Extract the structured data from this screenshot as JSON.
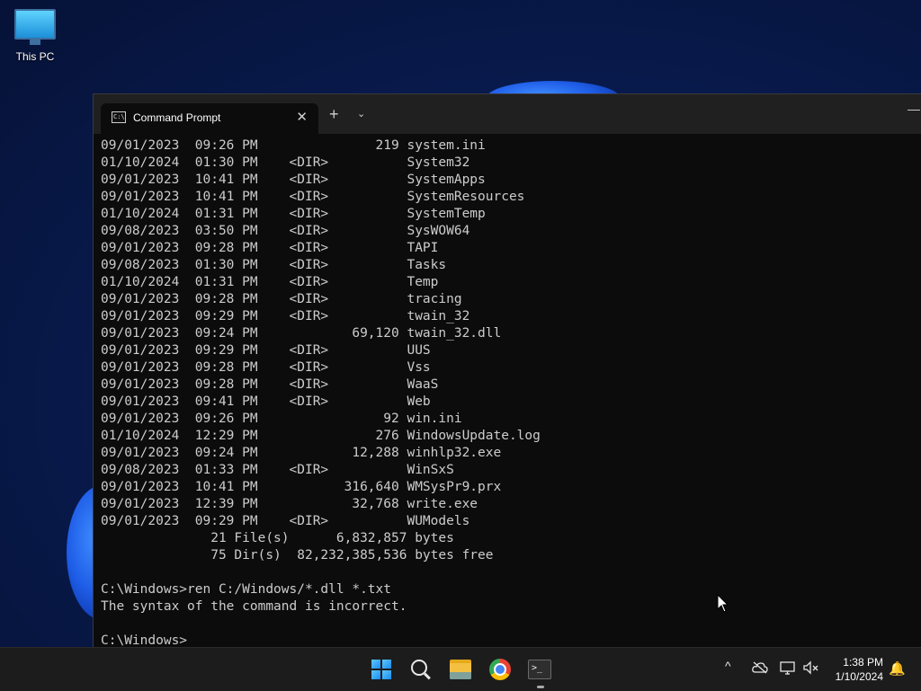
{
  "desktop": {
    "icons": [
      {
        "label": "This PC",
        "icon": "monitor-icon"
      }
    ]
  },
  "terminal": {
    "tab_title": "Command Prompt",
    "new_tab": "+",
    "dropdown": "⌄",
    "close": "✕",
    "minimize": "—",
    "lines": [
      "09/01/2023  09:26 PM               219 system.ini",
      "01/10/2024  01:30 PM    <DIR>          System32",
      "09/01/2023  10:41 PM    <DIR>          SystemApps",
      "09/01/2023  10:41 PM    <DIR>          SystemResources",
      "01/10/2024  01:31 PM    <DIR>          SystemTemp",
      "09/08/2023  03:50 PM    <DIR>          SysWOW64",
      "09/01/2023  09:28 PM    <DIR>          TAPI",
      "09/08/2023  01:30 PM    <DIR>          Tasks",
      "01/10/2024  01:31 PM    <DIR>          Temp",
      "09/01/2023  09:28 PM    <DIR>          tracing",
      "09/01/2023  09:29 PM    <DIR>          twain_32",
      "09/01/2023  09:24 PM            69,120 twain_32.dll",
      "09/01/2023  09:29 PM    <DIR>          UUS",
      "09/01/2023  09:28 PM    <DIR>          Vss",
      "09/01/2023  09:28 PM    <DIR>          WaaS",
      "09/01/2023  09:41 PM    <DIR>          Web",
      "09/01/2023  09:26 PM                92 win.ini",
      "01/10/2024  12:29 PM               276 WindowsUpdate.log",
      "09/01/2023  09:24 PM            12,288 winhlp32.exe",
      "09/08/2023  01:33 PM    <DIR>          WinSxS",
      "09/01/2023  10:41 PM           316,640 WMSysPr9.prx",
      "09/01/2023  12:39 PM            32,768 write.exe",
      "09/01/2023  09:29 PM    <DIR>          WUModels",
      "              21 File(s)      6,832,857 bytes",
      "              75 Dir(s)  82,232,385,536 bytes free",
      "",
      "C:\\Windows>ren C:/Windows/*.dll *.txt",
      "The syntax of the command is incorrect.",
      "",
      "C:\\Windows>"
    ]
  },
  "taskbar": {
    "apps": [
      {
        "name": "start",
        "icon": "windows-start-icon"
      },
      {
        "name": "search",
        "icon": "search-icon"
      },
      {
        "name": "file-explorer",
        "icon": "folder-icon"
      },
      {
        "name": "chrome",
        "icon": "chrome-icon"
      },
      {
        "name": "terminal",
        "icon": "terminal-icon",
        "active": true
      }
    ],
    "tray": {
      "chevron": "^",
      "time": "1:38 PM",
      "date": "1/10/2024"
    }
  },
  "colors": {
    "console_bg": "#0c0c0c",
    "console_fg": "#cccccc",
    "titlebar_bg": "#202020",
    "taskbar_bg": "#1c1c1c"
  }
}
